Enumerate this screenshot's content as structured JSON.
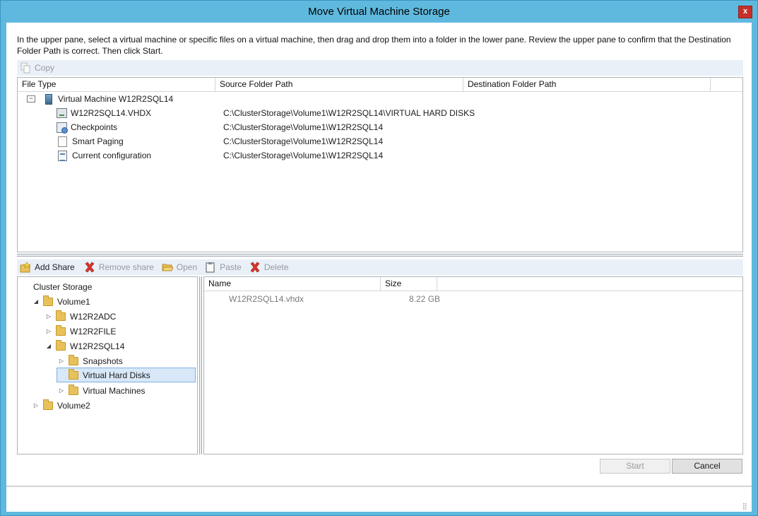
{
  "window": {
    "title": "Move Virtual Machine Storage",
    "close_label": "x"
  },
  "instructions": "In the upper pane, select a virtual machine or specific files on a virtual machine, then drag and drop them into a folder in the lower pane.  Review the upper pane to confirm that the Destination Folder Path is correct. Then click Start.",
  "upper_toolbar": {
    "copy_label": "Copy",
    "copy_icon": "copy-icon"
  },
  "upper_table": {
    "columns": [
      "File Type",
      "Source Folder Path",
      "Destination Folder Path"
    ],
    "vm": {
      "expander": "−",
      "label": "Virtual Machine W12R2SQL14",
      "icon": "server-icon"
    },
    "rows": [
      {
        "type": "W12R2SQL14.VHDX",
        "source": "C:\\ClusterStorage\\Volume1\\W12R2SQL14\\VIRTUAL HARD DISKS",
        "dest": "",
        "icon": "hard-disk-icon"
      },
      {
        "type": "Checkpoints",
        "source": "C:\\ClusterStorage\\Volume1\\W12R2SQL14",
        "dest": "",
        "icon": "checkpoint-icon"
      },
      {
        "type": "Smart Paging",
        "source": "C:\\ClusterStorage\\Volume1\\W12R2SQL14",
        "dest": "",
        "icon": "document-icon"
      },
      {
        "type": "Current configuration",
        "source": "C:\\ClusterStorage\\Volume1\\W12R2SQL14",
        "dest": "",
        "icon": "config-icon"
      }
    ]
  },
  "lower_toolbar": {
    "add_share": "Add Share",
    "remove_share": "Remove share",
    "open": "Open",
    "paste": "Paste",
    "delete": "Delete"
  },
  "tree": {
    "root": "Cluster Storage",
    "nodes": [
      {
        "label": "Volume1",
        "expander": "◢"
      },
      {
        "label": "W12R2ADC",
        "expander": "▷"
      },
      {
        "label": "W12R2FILE",
        "expander": "▷"
      },
      {
        "label": "W12R2SQL14",
        "expander": "◢"
      },
      {
        "label": "Snapshots",
        "expander": "▷"
      },
      {
        "label": "Virtual Hard Disks",
        "expander": "",
        "selected": true
      },
      {
        "label": "Virtual Machines",
        "expander": "▷"
      },
      {
        "label": "Volume2",
        "expander": "▷"
      }
    ]
  },
  "file_list": {
    "columns": [
      "Name",
      "Size"
    ],
    "rows": [
      {
        "name": "W12R2SQL14.vhdx",
        "size": "8.22 GB"
      }
    ]
  },
  "buttons": {
    "start": "Start",
    "cancel": "Cancel"
  },
  "grip": "⣿",
  "colors": {
    "title_bar": "#5fb9de",
    "close_button": "#c7302a",
    "toolbar_bg": "#e9f0f8",
    "selection": "#d8e8f8"
  }
}
